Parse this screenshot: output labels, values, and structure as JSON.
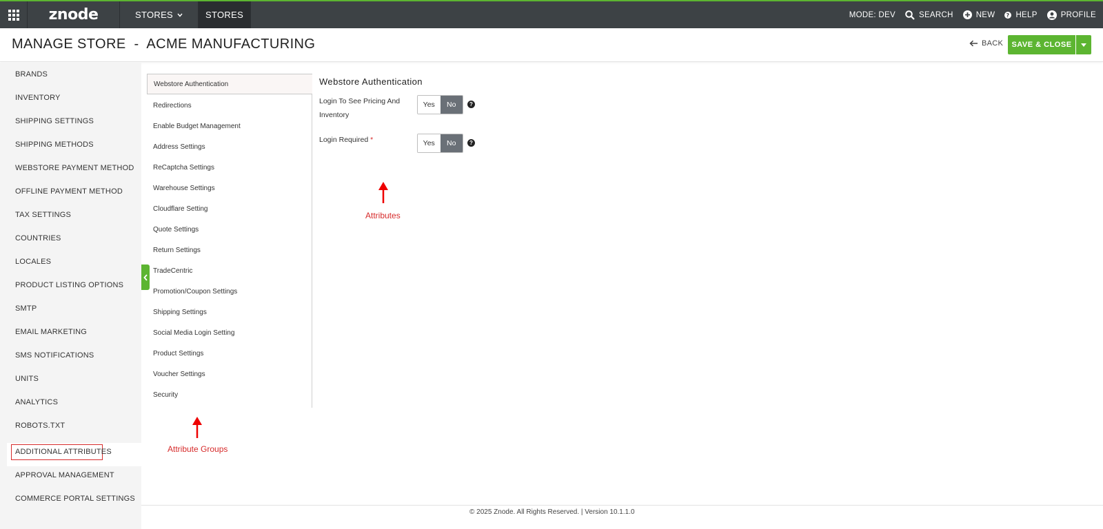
{
  "topbar": {
    "logo": "znode",
    "stores_menu": "STORES",
    "active_tab": "STORES",
    "mode": "MODE: DEV",
    "search": "SEARCH",
    "new": "NEW",
    "help": "HELP",
    "profile": "PROFILE"
  },
  "header": {
    "title": "MANAGE STORE  -  ACME MANUFACTURING",
    "back_label": "BACK",
    "save_label": "SAVE & CLOSE"
  },
  "sidebar": {
    "items": [
      "BRANDS",
      "INVENTORY",
      "SHIPPING SETTINGS",
      "SHIPPING METHODS",
      "WEBSTORE PAYMENT METHOD",
      "OFFLINE PAYMENT METHOD",
      "TAX SETTINGS",
      "COUNTRIES",
      "LOCALES",
      "PRODUCT LISTING OPTIONS",
      "SMTP",
      "EMAIL MARKETING",
      "SMS NOTIFICATIONS",
      "UNITS",
      "ANALYTICS",
      "ROBOTS.TXT",
      "ADDITIONAL ATTRIBUTES",
      "APPROVAL MANAGEMENT",
      "COMMERCE PORTAL SETTINGS"
    ],
    "active_index": 16
  },
  "groups": {
    "items": [
      "Webstore Authentication",
      "Redirections",
      "Enable Budget Management",
      "Address Settings",
      "ReCaptcha Settings",
      "Warehouse Settings",
      "Cloudflare Setting",
      "Quote Settings",
      "Return Settings",
      "TradeCentric",
      "Promotion/Coupon Settings",
      "Shipping Settings",
      "Social Media Login Setting",
      "Product Settings",
      "Voucher Settings",
      "Security"
    ],
    "active_index": 0
  },
  "attributes": {
    "title": "Webstore Authentication",
    "fields": [
      {
        "label": "Login To See Pricing And Inventory",
        "required": false,
        "value": "No"
      },
      {
        "label": "Login Required",
        "required": true,
        "value": "No"
      }
    ],
    "yes_label": "Yes",
    "no_label": "No",
    "required_mark": "*",
    "help_glyph": "?"
  },
  "annotations": {
    "attributes": "Attributes",
    "attribute_groups": "Attribute Groups",
    "color": "#d62a2a"
  },
  "footer": {
    "text": "© 2025 Znode. All Rights Reserved. | Version 10.1.1.0"
  },
  "colors": {
    "brand_green": "#5cb531",
    "topbar": "#3d4245",
    "toggle_selected": "#6a7077"
  }
}
